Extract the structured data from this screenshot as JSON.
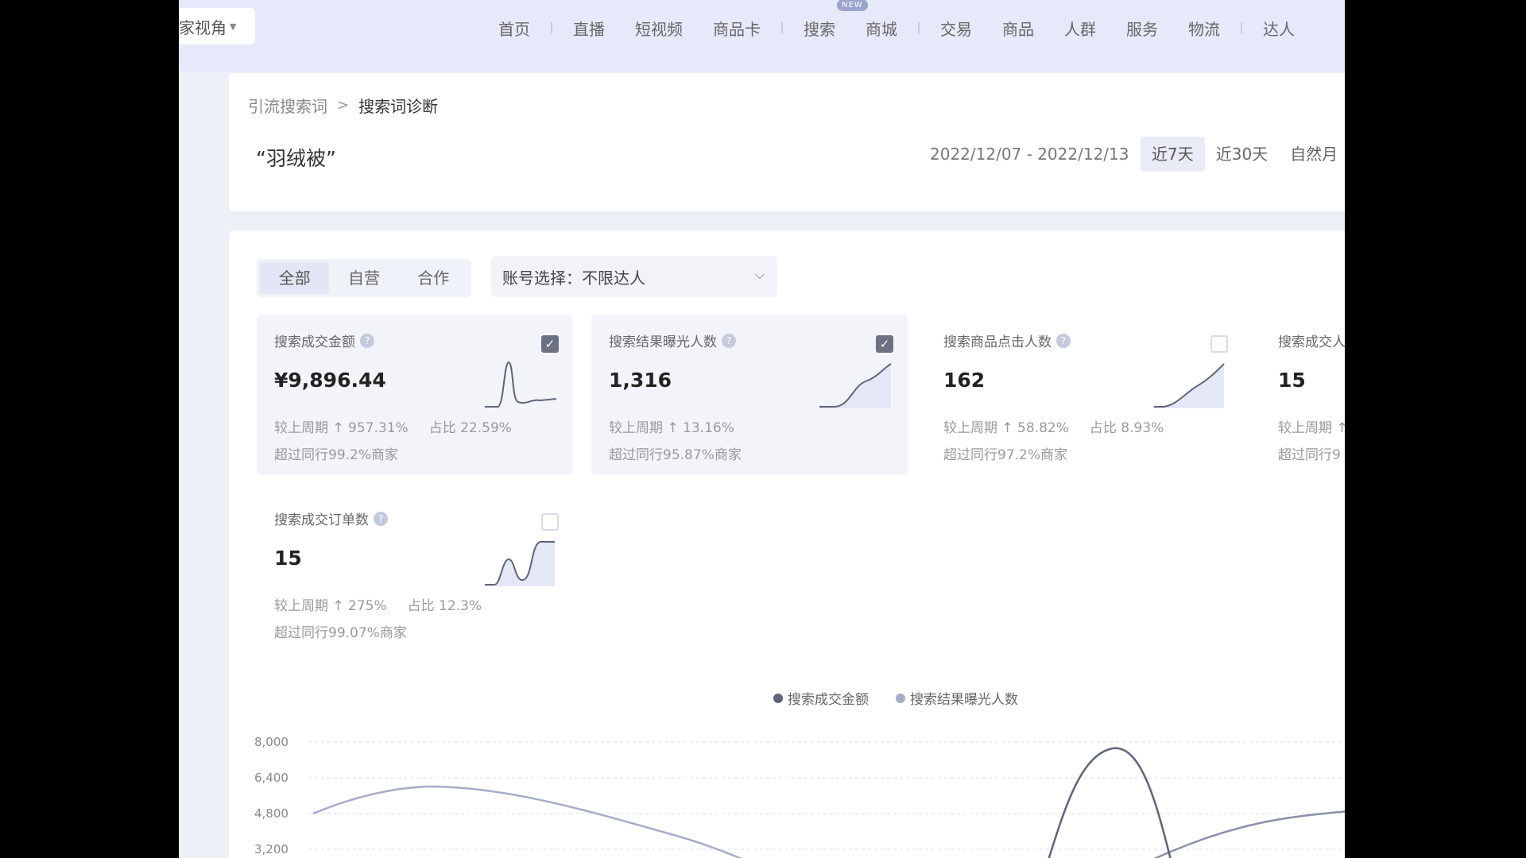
{
  "topbar": {
    "perspective_label": "家视角",
    "nav": [
      {
        "label": "首页"
      },
      {
        "label": "直播"
      },
      {
        "label": "短视频"
      },
      {
        "label": "商品卡"
      },
      {
        "label": "搜索",
        "badge": "NEW"
      },
      {
        "label": "商城"
      },
      {
        "label": "交易"
      },
      {
        "label": "商品"
      },
      {
        "label": "人群"
      },
      {
        "label": "服务"
      },
      {
        "label": "物流"
      },
      {
        "label": "达人"
      }
    ]
  },
  "header": {
    "breadcrumb": {
      "parent": "引流搜索词",
      "separator": ">",
      "current": "搜索词诊断"
    },
    "keyword": "“羽绒被”",
    "date_range": "2022/12/07 - 2022/12/13",
    "range_tabs": [
      "近7天",
      "近30天",
      "自然月"
    ],
    "active_range": "近7天"
  },
  "filters": {
    "segments": [
      "全部",
      "自营",
      "合作"
    ],
    "active_segment": "全部",
    "account_label": "账号选择：",
    "account_value": "不限达人"
  },
  "metrics": [
    {
      "title": "搜索成交金额",
      "value": "¥9,896.44",
      "wow": "较上周期 ↑ 957.31%",
      "share": "占比 22.59%",
      "peer": "超过同行99.2%商家",
      "checked": true
    },
    {
      "title": "搜索结果曝光人数",
      "value": "1,316",
      "wow": "较上周期 ↑ 13.16%",
      "share": "",
      "peer": "超过同行95.87%商家",
      "checked": true
    },
    {
      "title": "搜索商品点击人数",
      "value": "162",
      "wow": "较上周期 ↑ 58.82%",
      "share": "占比 8.93%",
      "peer": "超过同行97.2%商家",
      "checked": false
    },
    {
      "title": "搜索成交人",
      "value": "15",
      "wow": "较上周期 ↑",
      "share": "",
      "peer": "超过同行9",
      "checked": false
    },
    {
      "title": "搜索成交订单数",
      "value": "15",
      "wow": "较上周期 ↑ 275%",
      "share": "占比 12.3%",
      "peer": "超过同行99.07%商家",
      "checked": false
    }
  ],
  "colors": {
    "accent": "#6d7184",
    "series1": "#5f6478",
    "series2": "#a7acc6"
  },
  "chart_data": {
    "type": "line",
    "series": [
      {
        "name": "搜索成交金额"
      },
      {
        "name": "搜索结果曝光人数"
      }
    ],
    "y_ticks": [
      "8,000",
      "6,400",
      "4,800",
      "3,200"
    ],
    "ylim": [
      3200,
      8000
    ],
    "grid": true,
    "legend_position": "top"
  }
}
